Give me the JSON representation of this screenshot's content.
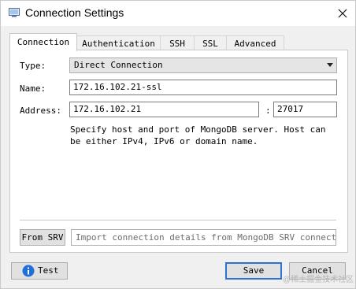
{
  "window": {
    "title": "Connection Settings"
  },
  "tabs": [
    {
      "label": "Connection",
      "active": true
    },
    {
      "label": "Authentication",
      "active": false
    },
    {
      "label": "SSH",
      "active": false
    },
    {
      "label": "SSL",
      "active": false
    },
    {
      "label": "Advanced",
      "active": false
    }
  ],
  "connection": {
    "type_label": "Type:",
    "type_value": "Direct Connection",
    "name_label": "Name:",
    "name_value": "172.16.102.21-ssl",
    "address_label": "Address:",
    "address_host": "172.16.102.21",
    "port_separator": ":",
    "address_port": "27017",
    "hint": "Specify host and port of MongoDB server. Host can be either IPv4, IPv6 or domain name."
  },
  "srv": {
    "button_label": "From SRV",
    "placeholder": "Import connection details from MongoDB SRV connection…"
  },
  "footer": {
    "test_label": "Test",
    "save_label": "Save",
    "cancel_label": "Cancel"
  },
  "watermark": "@稀土掘金技术社区",
  "colors": {
    "accent": "#2c73d2",
    "info": "#1e6fd9"
  }
}
